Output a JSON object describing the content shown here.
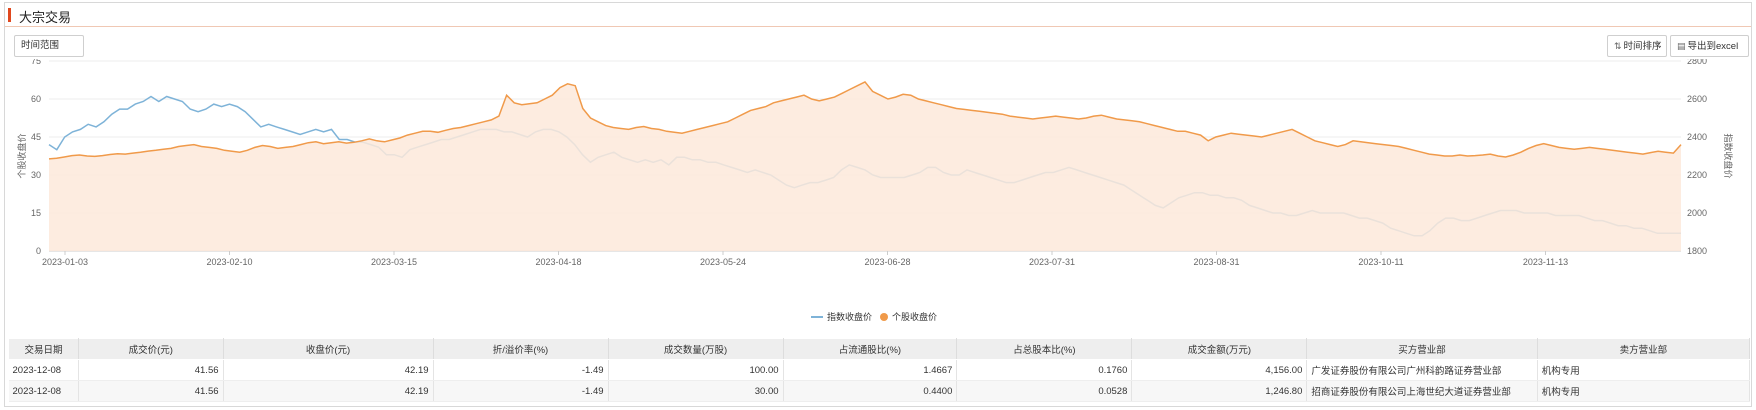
{
  "header": {
    "title": "大宗交易"
  },
  "toolbar": {
    "range_label": "时间范围",
    "sort_label": "时间排序",
    "export_label": "导出到excel"
  },
  "chart_data": {
    "type": "line",
    "x_tick_labels": [
      "2023-01-03",
      "2023-02-10",
      "2023-03-15",
      "2023-04-18",
      "2023-05-24",
      "2023-06-28",
      "2023-07-31",
      "2023-08-31",
      "2023-10-11",
      "2023-11-13"
    ],
    "left_axis": {
      "label": "个股收盘价",
      "ticks": [
        0,
        15,
        30,
        45,
        60,
        75
      ],
      "range": [
        0,
        75
      ]
    },
    "right_axis": {
      "label": "指数收盘价",
      "ticks": [
        1800,
        2000,
        2200,
        2400,
        2600,
        2800
      ],
      "range": [
        1800,
        2800
      ]
    },
    "legend_position": "bottom-center",
    "grid": true,
    "series": [
      {
        "name": "指数收盘价",
        "axis": "left",
        "color": "#7eb3d8",
        "values": [
          42,
          40,
          45,
          47,
          48,
          50,
          49,
          51,
          54,
          56,
          56,
          58,
          59,
          61,
          59,
          61,
          60,
          59,
          56,
          55,
          56,
          58,
          57,
          58,
          57,
          55,
          52,
          49,
          50,
          49,
          48,
          47,
          46,
          47,
          48,
          47,
          48,
          44,
          44,
          43,
          43,
          42,
          41,
          38,
          38,
          37,
          40,
          41,
          42,
          43,
          44,
          44,
          45,
          46,
          47,
          48,
          48,
          48,
          47,
          47,
          46,
          45,
          47,
          48,
          48,
          47,
          45,
          42,
          38,
          35,
          37,
          38,
          39,
          37,
          36,
          35,
          36,
          35,
          36,
          34,
          37,
          37,
          36,
          36,
          35,
          35,
          34,
          33,
          32,
          31,
          32,
          31,
          30,
          28,
          26,
          25,
          26,
          27,
          27,
          28,
          29,
          32,
          34,
          33,
          32,
          30,
          29,
          29,
          29,
          29,
          30,
          31,
          33,
          33,
          31,
          30,
          30,
          32,
          31,
          30,
          29,
          28,
          27,
          27,
          28,
          29,
          30,
          31,
          31,
          32,
          33,
          32,
          31,
          30,
          29,
          28,
          27,
          26,
          24,
          22,
          20,
          18,
          17,
          19,
          21,
          22,
          23,
          23,
          22,
          22,
          21,
          21,
          20,
          18,
          17,
          16,
          15,
          15,
          14,
          14,
          15,
          16,
          15,
          15,
          15,
          15,
          14,
          13,
          13,
          12,
          11,
          9,
          8,
          7,
          6,
          6,
          8,
          11,
          13,
          13,
          12,
          12,
          13,
          14,
          15,
          16,
          16,
          16,
          15,
          15,
          15,
          15,
          14,
          14,
          14,
          14,
          13,
          12,
          12,
          11,
          10,
          10,
          9,
          9,
          8,
          7,
          7,
          7,
          7
        ]
      },
      {
        "name": "个股收盘价",
        "axis": "right",
        "color": "#f09a4a",
        "values": [
          2285,
          2288,
          2295,
          2302,
          2305,
          2300,
          2298,
          2302,
          2308,
          2312,
          2310,
          2315,
          2320,
          2326,
          2330,
          2335,
          2340,
          2350,
          2355,
          2360,
          2350,
          2345,
          2340,
          2330,
          2325,
          2320,
          2330,
          2345,
          2355,
          2350,
          2340,
          2345,
          2350,
          2360,
          2370,
          2375,
          2365,
          2370,
          2375,
          2368,
          2372,
          2380,
          2390,
          2380,
          2375,
          2385,
          2395,
          2410,
          2420,
          2430,
          2430,
          2425,
          2435,
          2445,
          2450,
          2460,
          2470,
          2480,
          2490,
          2510,
          2620,
          2580,
          2570,
          2575,
          2580,
          2600,
          2620,
          2660,
          2680,
          2670,
          2550,
          2500,
          2480,
          2460,
          2450,
          2445,
          2440,
          2450,
          2455,
          2445,
          2440,
          2430,
          2425,
          2420,
          2430,
          2440,
          2450,
          2460,
          2470,
          2480,
          2500,
          2520,
          2540,
          2550,
          2560,
          2580,
          2590,
          2600,
          2610,
          2620,
          2600,
          2590,
          2600,
          2610,
          2630,
          2650,
          2670,
          2690,
          2640,
          2620,
          2600,
          2610,
          2625,
          2620,
          2600,
          2590,
          2580,
          2570,
          2560,
          2550,
          2545,
          2540,
          2535,
          2530,
          2525,
          2520,
          2510,
          2505,
          2500,
          2495,
          2500,
          2505,
          2510,
          2505,
          2500,
          2495,
          2500,
          2510,
          2515,
          2505,
          2495,
          2490,
          2485,
          2480,
          2470,
          2460,
          2450,
          2440,
          2430,
          2430,
          2420,
          2410,
          2380,
          2400,
          2410,
          2420,
          2415,
          2410,
          2405,
          2400,
          2410,
          2420,
          2430,
          2440,
          2420,
          2400,
          2380,
          2370,
          2360,
          2350,
          2360,
          2380,
          2375,
          2370,
          2365,
          2360,
          2355,
          2350,
          2340,
          2330,
          2320,
          2310,
          2305,
          2300,
          2300,
          2305,
          2300,
          2302,
          2305,
          2310,
          2300,
          2295,
          2305,
          2320,
          2340,
          2355,
          2365,
          2355,
          2345,
          2340,
          2335,
          2340,
          2345,
          2340,
          2335,
          2330,
          2325,
          2320,
          2315,
          2310,
          2318,
          2325,
          2320,
          2315,
          2360
        ]
      }
    ]
  },
  "table": {
    "columns": [
      "交易日期",
      "成交价(元)",
      "收盘价(元)",
      "折/溢价率(%)",
      "成交数量(万股)",
      "占流通股比(%)",
      "占总股本比(%)",
      "成交金额(万元)",
      "买方营业部",
      "卖方营业部"
    ],
    "rows": [
      [
        "2023-12-08",
        "41.56",
        "42.19",
        "-1.49",
        "100.00",
        "1.4667",
        "0.1760",
        "4,156.00",
        "广发证券股份有限公司广州科韵路证券营业部",
        "机构专用"
      ],
      [
        "2023-12-08",
        "41.56",
        "42.19",
        "-1.49",
        "30.00",
        "0.4400",
        "0.0528",
        "1,246.80",
        "招商证券股份有限公司上海世纪大道证券营业部",
        "机构专用"
      ]
    ]
  }
}
